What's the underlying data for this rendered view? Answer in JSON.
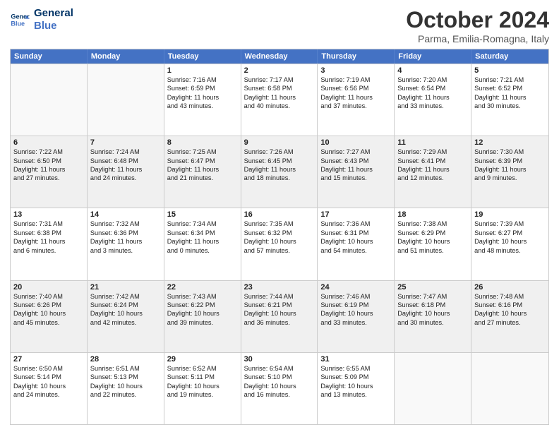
{
  "logo": {
    "line1": "General",
    "line2": "Blue"
  },
  "title": "October 2024",
  "subtitle": "Parma, Emilia-Romagna, Italy",
  "weekdays": [
    "Sunday",
    "Monday",
    "Tuesday",
    "Wednesday",
    "Thursday",
    "Friday",
    "Saturday"
  ],
  "rows": [
    [
      {
        "day": "",
        "lines": [],
        "empty": true
      },
      {
        "day": "",
        "lines": [],
        "empty": true
      },
      {
        "day": "1",
        "lines": [
          "Sunrise: 7:16 AM",
          "Sunset: 6:59 PM",
          "Daylight: 11 hours",
          "and 43 minutes."
        ]
      },
      {
        "day": "2",
        "lines": [
          "Sunrise: 7:17 AM",
          "Sunset: 6:58 PM",
          "Daylight: 11 hours",
          "and 40 minutes."
        ]
      },
      {
        "day": "3",
        "lines": [
          "Sunrise: 7:19 AM",
          "Sunset: 6:56 PM",
          "Daylight: 11 hours",
          "and 37 minutes."
        ]
      },
      {
        "day": "4",
        "lines": [
          "Sunrise: 7:20 AM",
          "Sunset: 6:54 PM",
          "Daylight: 11 hours",
          "and 33 minutes."
        ]
      },
      {
        "day": "5",
        "lines": [
          "Sunrise: 7:21 AM",
          "Sunset: 6:52 PM",
          "Daylight: 11 hours",
          "and 30 minutes."
        ]
      }
    ],
    [
      {
        "day": "6",
        "lines": [
          "Sunrise: 7:22 AM",
          "Sunset: 6:50 PM",
          "Daylight: 11 hours",
          "and 27 minutes."
        ]
      },
      {
        "day": "7",
        "lines": [
          "Sunrise: 7:24 AM",
          "Sunset: 6:48 PM",
          "Daylight: 11 hours",
          "and 24 minutes."
        ]
      },
      {
        "day": "8",
        "lines": [
          "Sunrise: 7:25 AM",
          "Sunset: 6:47 PM",
          "Daylight: 11 hours",
          "and 21 minutes."
        ]
      },
      {
        "day": "9",
        "lines": [
          "Sunrise: 7:26 AM",
          "Sunset: 6:45 PM",
          "Daylight: 11 hours",
          "and 18 minutes."
        ]
      },
      {
        "day": "10",
        "lines": [
          "Sunrise: 7:27 AM",
          "Sunset: 6:43 PM",
          "Daylight: 11 hours",
          "and 15 minutes."
        ]
      },
      {
        "day": "11",
        "lines": [
          "Sunrise: 7:29 AM",
          "Sunset: 6:41 PM",
          "Daylight: 11 hours",
          "and 12 minutes."
        ]
      },
      {
        "day": "12",
        "lines": [
          "Sunrise: 7:30 AM",
          "Sunset: 6:39 PM",
          "Daylight: 11 hours",
          "and 9 minutes."
        ]
      }
    ],
    [
      {
        "day": "13",
        "lines": [
          "Sunrise: 7:31 AM",
          "Sunset: 6:38 PM",
          "Daylight: 11 hours",
          "and 6 minutes."
        ]
      },
      {
        "day": "14",
        "lines": [
          "Sunrise: 7:32 AM",
          "Sunset: 6:36 PM",
          "Daylight: 11 hours",
          "and 3 minutes."
        ]
      },
      {
        "day": "15",
        "lines": [
          "Sunrise: 7:34 AM",
          "Sunset: 6:34 PM",
          "Daylight: 11 hours",
          "and 0 minutes."
        ]
      },
      {
        "day": "16",
        "lines": [
          "Sunrise: 7:35 AM",
          "Sunset: 6:32 PM",
          "Daylight: 10 hours",
          "and 57 minutes."
        ]
      },
      {
        "day": "17",
        "lines": [
          "Sunrise: 7:36 AM",
          "Sunset: 6:31 PM",
          "Daylight: 10 hours",
          "and 54 minutes."
        ]
      },
      {
        "day": "18",
        "lines": [
          "Sunrise: 7:38 AM",
          "Sunset: 6:29 PM",
          "Daylight: 10 hours",
          "and 51 minutes."
        ]
      },
      {
        "day": "19",
        "lines": [
          "Sunrise: 7:39 AM",
          "Sunset: 6:27 PM",
          "Daylight: 10 hours",
          "and 48 minutes."
        ]
      }
    ],
    [
      {
        "day": "20",
        "lines": [
          "Sunrise: 7:40 AM",
          "Sunset: 6:26 PM",
          "Daylight: 10 hours",
          "and 45 minutes."
        ]
      },
      {
        "day": "21",
        "lines": [
          "Sunrise: 7:42 AM",
          "Sunset: 6:24 PM",
          "Daylight: 10 hours",
          "and 42 minutes."
        ]
      },
      {
        "day": "22",
        "lines": [
          "Sunrise: 7:43 AM",
          "Sunset: 6:22 PM",
          "Daylight: 10 hours",
          "and 39 minutes."
        ]
      },
      {
        "day": "23",
        "lines": [
          "Sunrise: 7:44 AM",
          "Sunset: 6:21 PM",
          "Daylight: 10 hours",
          "and 36 minutes."
        ]
      },
      {
        "day": "24",
        "lines": [
          "Sunrise: 7:46 AM",
          "Sunset: 6:19 PM",
          "Daylight: 10 hours",
          "and 33 minutes."
        ]
      },
      {
        "day": "25",
        "lines": [
          "Sunrise: 7:47 AM",
          "Sunset: 6:18 PM",
          "Daylight: 10 hours",
          "and 30 minutes."
        ]
      },
      {
        "day": "26",
        "lines": [
          "Sunrise: 7:48 AM",
          "Sunset: 6:16 PM",
          "Daylight: 10 hours",
          "and 27 minutes."
        ]
      }
    ],
    [
      {
        "day": "27",
        "lines": [
          "Sunrise: 6:50 AM",
          "Sunset: 5:14 PM",
          "Daylight: 10 hours",
          "and 24 minutes."
        ]
      },
      {
        "day": "28",
        "lines": [
          "Sunrise: 6:51 AM",
          "Sunset: 5:13 PM",
          "Daylight: 10 hours",
          "and 22 minutes."
        ]
      },
      {
        "day": "29",
        "lines": [
          "Sunrise: 6:52 AM",
          "Sunset: 5:11 PM",
          "Daylight: 10 hours",
          "and 19 minutes."
        ]
      },
      {
        "day": "30",
        "lines": [
          "Sunrise: 6:54 AM",
          "Sunset: 5:10 PM",
          "Daylight: 10 hours",
          "and 16 minutes."
        ]
      },
      {
        "day": "31",
        "lines": [
          "Sunrise: 6:55 AM",
          "Sunset: 5:09 PM",
          "Daylight: 10 hours",
          "and 13 minutes."
        ]
      },
      {
        "day": "",
        "lines": [],
        "empty": true
      },
      {
        "day": "",
        "lines": [],
        "empty": true
      }
    ]
  ]
}
